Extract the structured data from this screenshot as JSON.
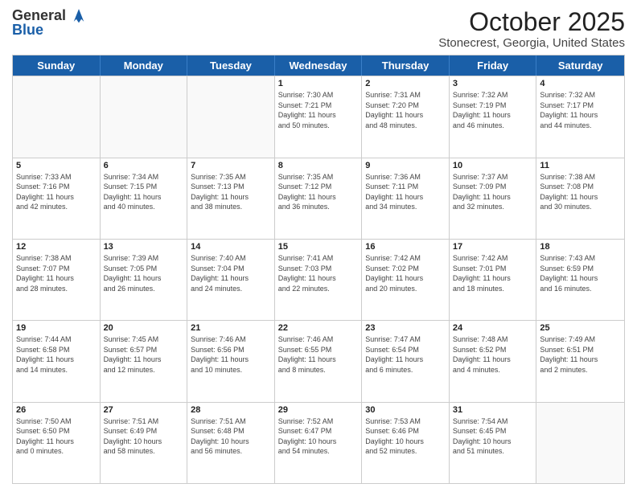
{
  "logo": {
    "general": "General",
    "blue": "Blue"
  },
  "title": "October 2025",
  "location": "Stonecrest, Georgia, United States",
  "days_of_week": [
    "Sunday",
    "Monday",
    "Tuesday",
    "Wednesday",
    "Thursday",
    "Friday",
    "Saturday"
  ],
  "weeks": [
    [
      {
        "day": "",
        "info": ""
      },
      {
        "day": "",
        "info": ""
      },
      {
        "day": "",
        "info": ""
      },
      {
        "day": "1",
        "info": "Sunrise: 7:30 AM\nSunset: 7:21 PM\nDaylight: 11 hours\nand 50 minutes."
      },
      {
        "day": "2",
        "info": "Sunrise: 7:31 AM\nSunset: 7:20 PM\nDaylight: 11 hours\nand 48 minutes."
      },
      {
        "day": "3",
        "info": "Sunrise: 7:32 AM\nSunset: 7:19 PM\nDaylight: 11 hours\nand 46 minutes."
      },
      {
        "day": "4",
        "info": "Sunrise: 7:32 AM\nSunset: 7:17 PM\nDaylight: 11 hours\nand 44 minutes."
      }
    ],
    [
      {
        "day": "5",
        "info": "Sunrise: 7:33 AM\nSunset: 7:16 PM\nDaylight: 11 hours\nand 42 minutes."
      },
      {
        "day": "6",
        "info": "Sunrise: 7:34 AM\nSunset: 7:15 PM\nDaylight: 11 hours\nand 40 minutes."
      },
      {
        "day": "7",
        "info": "Sunrise: 7:35 AM\nSunset: 7:13 PM\nDaylight: 11 hours\nand 38 minutes."
      },
      {
        "day": "8",
        "info": "Sunrise: 7:35 AM\nSunset: 7:12 PM\nDaylight: 11 hours\nand 36 minutes."
      },
      {
        "day": "9",
        "info": "Sunrise: 7:36 AM\nSunset: 7:11 PM\nDaylight: 11 hours\nand 34 minutes."
      },
      {
        "day": "10",
        "info": "Sunrise: 7:37 AM\nSunset: 7:09 PM\nDaylight: 11 hours\nand 32 minutes."
      },
      {
        "day": "11",
        "info": "Sunrise: 7:38 AM\nSunset: 7:08 PM\nDaylight: 11 hours\nand 30 minutes."
      }
    ],
    [
      {
        "day": "12",
        "info": "Sunrise: 7:38 AM\nSunset: 7:07 PM\nDaylight: 11 hours\nand 28 minutes."
      },
      {
        "day": "13",
        "info": "Sunrise: 7:39 AM\nSunset: 7:05 PM\nDaylight: 11 hours\nand 26 minutes."
      },
      {
        "day": "14",
        "info": "Sunrise: 7:40 AM\nSunset: 7:04 PM\nDaylight: 11 hours\nand 24 minutes."
      },
      {
        "day": "15",
        "info": "Sunrise: 7:41 AM\nSunset: 7:03 PM\nDaylight: 11 hours\nand 22 minutes."
      },
      {
        "day": "16",
        "info": "Sunrise: 7:42 AM\nSunset: 7:02 PM\nDaylight: 11 hours\nand 20 minutes."
      },
      {
        "day": "17",
        "info": "Sunrise: 7:42 AM\nSunset: 7:01 PM\nDaylight: 11 hours\nand 18 minutes."
      },
      {
        "day": "18",
        "info": "Sunrise: 7:43 AM\nSunset: 6:59 PM\nDaylight: 11 hours\nand 16 minutes."
      }
    ],
    [
      {
        "day": "19",
        "info": "Sunrise: 7:44 AM\nSunset: 6:58 PM\nDaylight: 11 hours\nand 14 minutes."
      },
      {
        "day": "20",
        "info": "Sunrise: 7:45 AM\nSunset: 6:57 PM\nDaylight: 11 hours\nand 12 minutes."
      },
      {
        "day": "21",
        "info": "Sunrise: 7:46 AM\nSunset: 6:56 PM\nDaylight: 11 hours\nand 10 minutes."
      },
      {
        "day": "22",
        "info": "Sunrise: 7:46 AM\nSunset: 6:55 PM\nDaylight: 11 hours\nand 8 minutes."
      },
      {
        "day": "23",
        "info": "Sunrise: 7:47 AM\nSunset: 6:54 PM\nDaylight: 11 hours\nand 6 minutes."
      },
      {
        "day": "24",
        "info": "Sunrise: 7:48 AM\nSunset: 6:52 PM\nDaylight: 11 hours\nand 4 minutes."
      },
      {
        "day": "25",
        "info": "Sunrise: 7:49 AM\nSunset: 6:51 PM\nDaylight: 11 hours\nand 2 minutes."
      }
    ],
    [
      {
        "day": "26",
        "info": "Sunrise: 7:50 AM\nSunset: 6:50 PM\nDaylight: 11 hours\nand 0 minutes."
      },
      {
        "day": "27",
        "info": "Sunrise: 7:51 AM\nSunset: 6:49 PM\nDaylight: 10 hours\nand 58 minutes."
      },
      {
        "day": "28",
        "info": "Sunrise: 7:51 AM\nSunset: 6:48 PM\nDaylight: 10 hours\nand 56 minutes."
      },
      {
        "day": "29",
        "info": "Sunrise: 7:52 AM\nSunset: 6:47 PM\nDaylight: 10 hours\nand 54 minutes."
      },
      {
        "day": "30",
        "info": "Sunrise: 7:53 AM\nSunset: 6:46 PM\nDaylight: 10 hours\nand 52 minutes."
      },
      {
        "day": "31",
        "info": "Sunrise: 7:54 AM\nSunset: 6:45 PM\nDaylight: 10 hours\nand 51 minutes."
      },
      {
        "day": "",
        "info": ""
      }
    ]
  ]
}
